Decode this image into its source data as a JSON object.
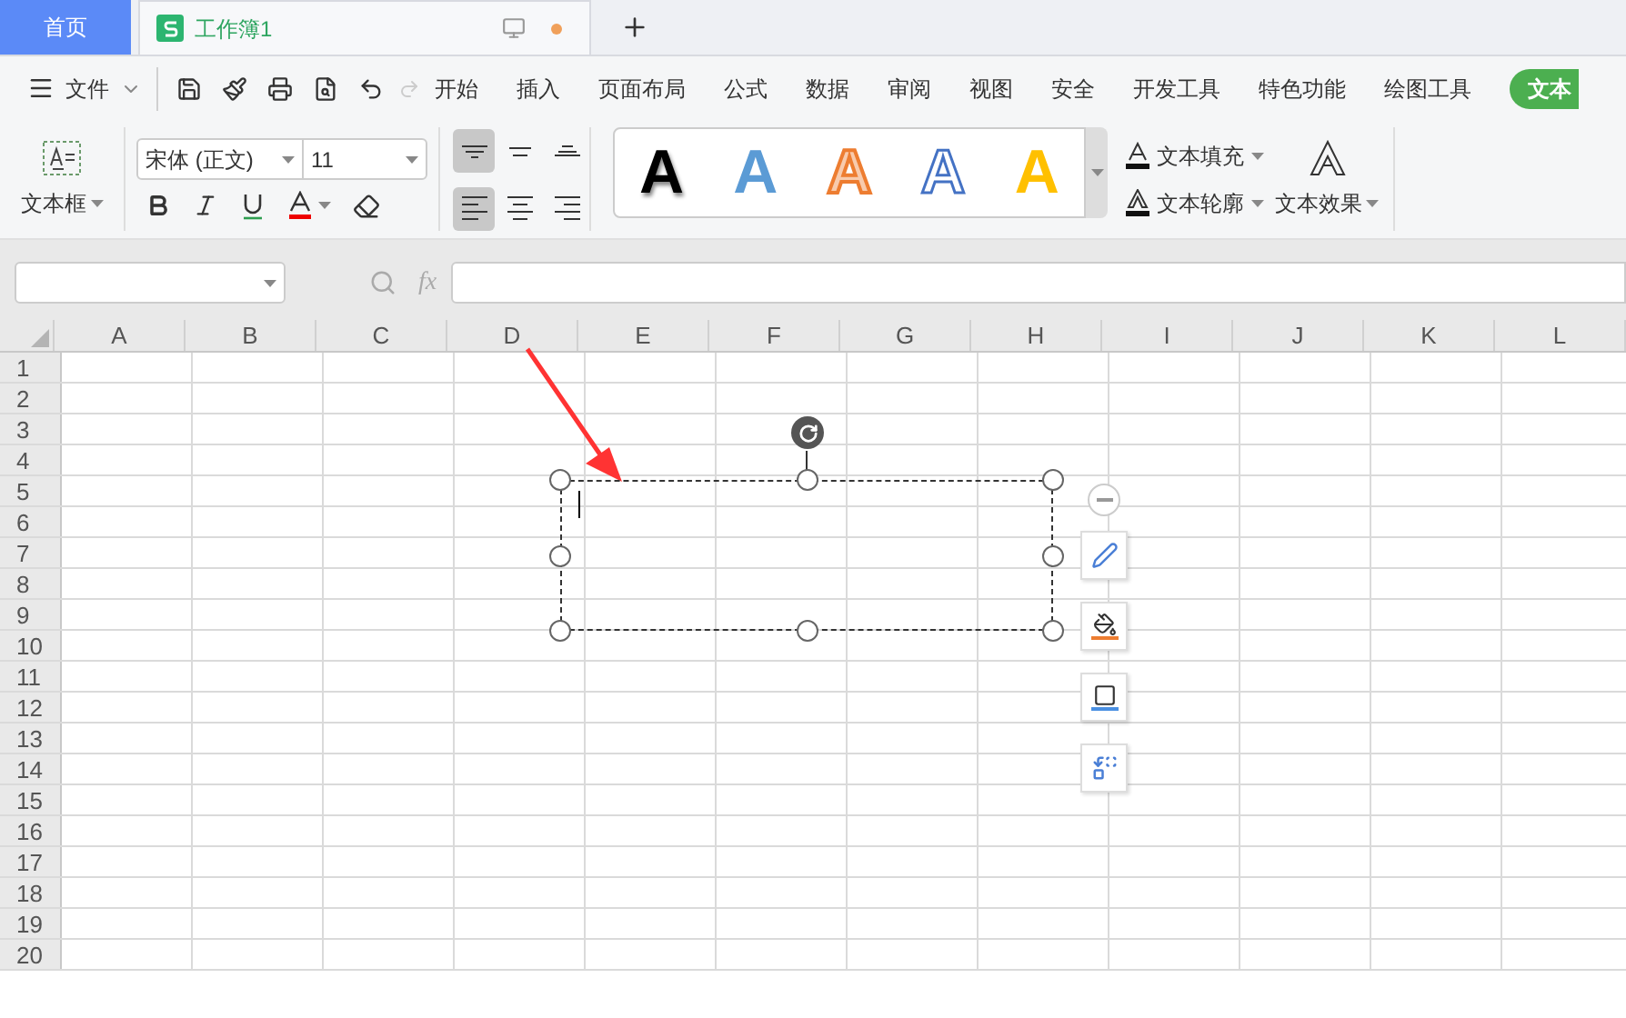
{
  "tabs": [
    {
      "label": "首页",
      "kind": "home",
      "selected": false
    },
    {
      "label": "工作簿1",
      "kind": "document",
      "selected": true
    }
  ],
  "menu": {
    "file": "文件",
    "tabs": [
      {
        "label": "开始",
        "selected": false
      },
      {
        "label": "插入",
        "selected": false
      },
      {
        "label": "页面布局",
        "selected": false
      },
      {
        "label": "公式",
        "selected": false
      },
      {
        "label": "数据",
        "selected": false
      },
      {
        "label": "审阅",
        "selected": false
      },
      {
        "label": "视图",
        "selected": false
      },
      {
        "label": "安全",
        "selected": false
      },
      {
        "label": "开发工具",
        "selected": false
      },
      {
        "label": "特色功能",
        "selected": false
      },
      {
        "label": "绘图工具",
        "selected": false
      },
      {
        "label": "文本",
        "selected": true
      }
    ]
  },
  "ribbon": {
    "textbox_label": "文本框",
    "font_name": "宋体 (正文)",
    "font_size": "11",
    "alignment": [
      {
        "kind": "top",
        "selected": true
      },
      {
        "kind": "middle",
        "selected": false
      },
      {
        "kind": "bottom",
        "selected": false
      },
      {
        "kind": "left",
        "selected": true
      },
      {
        "kind": "center",
        "selected": false
      },
      {
        "kind": "right",
        "selected": false
      }
    ],
    "wordart": [
      {
        "label": "A",
        "kind": "black"
      },
      {
        "label": "A",
        "kind": "blue"
      },
      {
        "label": "A",
        "kind": "orange-outline"
      },
      {
        "label": "A",
        "kind": "blue-outline"
      },
      {
        "label": "A",
        "kind": "yellow"
      }
    ],
    "text_fill": "文本填充",
    "text_outline": "文本轮廓",
    "text_effect": "文本效果"
  },
  "formula_bar": {
    "function_label": "fx"
  },
  "sheet": {
    "columns": [
      "A",
      "B",
      "C",
      "D",
      "E",
      "F",
      "G",
      "H",
      "I",
      "J",
      "K",
      "L"
    ],
    "rows": [
      "1",
      "2",
      "3",
      "4",
      "5",
      "6",
      "7",
      "8",
      "9",
      "10",
      "11",
      "12",
      "13",
      "14",
      "15",
      "16",
      "17",
      "18",
      "19",
      "20"
    ]
  }
}
